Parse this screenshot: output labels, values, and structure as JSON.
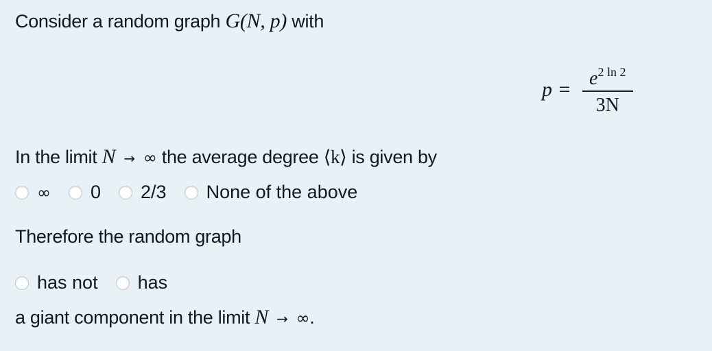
{
  "intro": {
    "text": "Consider a random graph",
    "math": "G(N, p)",
    "suffix": "with"
  },
  "formula": {
    "lhs": "p =",
    "numerator_base": "e",
    "numerator_exp": "2",
    "numerator_rest": "ln 2",
    "denominator": "3N"
  },
  "question1": {
    "prefix": "In the limit",
    "var": "N",
    "arrow": "→",
    "limit": "∞",
    "middle": "the average degree",
    "bracket": "⟨k⟩",
    "suffix": "is given by",
    "options": [
      "∞",
      "0",
      "2/3",
      "None of the above"
    ]
  },
  "question2": {
    "prompt": "Therefore the random graph",
    "options": [
      "has not",
      "has"
    ],
    "tail_prefix": "a giant component in the limit",
    "var": "N",
    "arrow": "→",
    "limit": "∞."
  }
}
